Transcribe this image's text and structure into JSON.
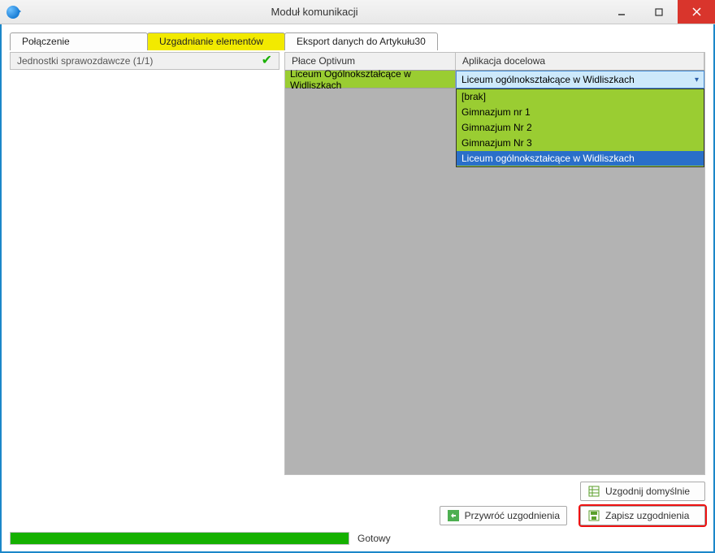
{
  "window": {
    "title": "Moduł komunikacji"
  },
  "tabs": {
    "connection": "Połączenie",
    "matching": "Uzgadnianie elementów",
    "export": "Eksport danych do Artykułu30"
  },
  "left": {
    "header": "Jednostki sprawozdawcze (1/1)"
  },
  "grid": {
    "header_a": "Płace Optivum",
    "header_b": "Aplikacja docelowa",
    "row0_a": "Liceum Ogólnokształcące w Widliszkach",
    "row0_b": "Liceum ogólnokształcące w Widliszkach"
  },
  "dropdown": {
    "items": [
      "[brak]",
      "Gimnazjum nr 1",
      "Gimnazjum Nr 2",
      "Gimnazjum Nr 3",
      "Liceum ogólnokształcące w Widliszkach"
    ],
    "selected_index": 4
  },
  "buttons": {
    "default_match": "Uzgodnij domyślnie",
    "restore": "Przywróć uzgodnienia",
    "save": "Zapisz uzgodnienia"
  },
  "status": {
    "text": "Gotowy",
    "progress_pct": 100
  },
  "colors": {
    "accent_yellow": "#f2ea00",
    "row_green": "#9acd32",
    "select_blue": "#2a6fc9",
    "drop_bg": "#cde9fb",
    "progress_green": "#15b000",
    "window_border": "#1b87c9"
  }
}
